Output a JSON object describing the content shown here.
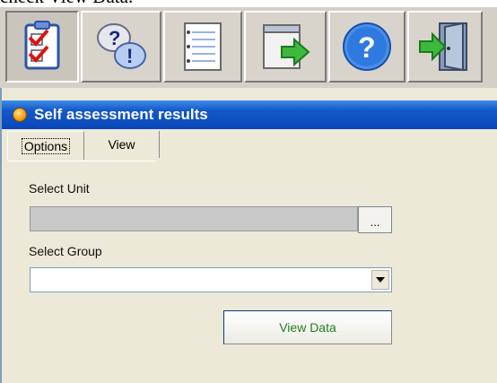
{
  "caption": "check View Data.",
  "toolbar": {
    "buttons": [
      {
        "icon": "checklist-icon"
      },
      {
        "icon": "question-bubbles-icon"
      },
      {
        "icon": "notepad-icon"
      },
      {
        "icon": "export-window-icon"
      },
      {
        "icon": "help-icon"
      },
      {
        "icon": "exit-door-icon"
      }
    ]
  },
  "panel": {
    "title": "Self assessment results",
    "tabs": [
      {
        "label": "Options",
        "active": true
      },
      {
        "label": "View",
        "active": false
      }
    ],
    "select_unit_label": "Select Unit",
    "unit_value": "",
    "browse_label": "...",
    "select_group_label": "Select Group",
    "group_value": "",
    "view_data_label": "View Data"
  }
}
